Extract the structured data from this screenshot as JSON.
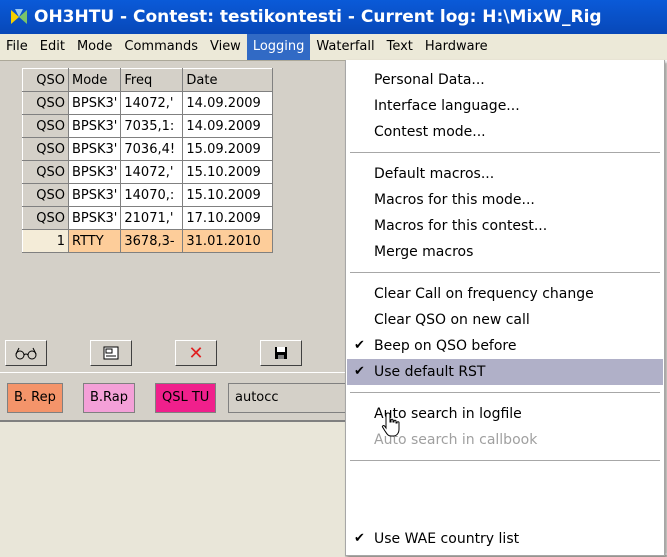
{
  "title": "OH3HTU - Contest: testikontesti - Current log: H:\\MixW_Rig",
  "menu": [
    "File",
    "Edit",
    "Mode",
    "Commands",
    "View",
    "Logging",
    "Waterfall",
    "Text",
    "Hardware"
  ],
  "table": {
    "headers": [
      "QSO",
      "Mode",
      "Freq",
      "Date"
    ],
    "rows": [
      [
        "QSO",
        "BPSK3'",
        "14072,'",
        "14.09.2009"
      ],
      [
        "QSO",
        "BPSK3'",
        "7035,1:",
        "14.09.2009"
      ],
      [
        "QSO",
        "BPSK3'",
        "7036,4!",
        "15.09.2009"
      ],
      [
        "QSO",
        "BPSK3'",
        "14072,'",
        "15.10.2009"
      ],
      [
        "QSO",
        "BPSK3'",
        "14070,:",
        "15.10.2009"
      ],
      [
        "QSO",
        "BPSK3'",
        "21071,'",
        "17.10.2009"
      ],
      [
        "1",
        "RTTY",
        "3678,3-",
        "31.01.2010"
      ]
    ]
  },
  "toolbar": [
    "glasses-icon",
    "card-icon",
    "delete-icon",
    "save-icon"
  ],
  "macros": [
    {
      "label": "B. Rep",
      "color": "#f4946a"
    },
    {
      "label": "B.Rap",
      "color": "#f4a0d8"
    },
    {
      "label": "QSL TU",
      "color": "#f0208c"
    },
    {
      "label": "autocc",
      "color": "#d4d0c8"
    }
  ],
  "logging_menu": {
    "items": [
      {
        "label": "Personal Data...",
        "checked": false,
        "disabled": false
      },
      {
        "label": "Interface language...",
        "checked": false,
        "disabled": false
      },
      {
        "label": "Contest mode...",
        "checked": false,
        "disabled": false
      },
      {
        "label": "Default macros...",
        "checked": false,
        "disabled": false
      },
      {
        "label": "Macros for this mode...",
        "checked": false,
        "disabled": false
      },
      {
        "label": "Macros for this contest...",
        "checked": false,
        "disabled": false
      },
      {
        "label": "Merge macros",
        "checked": false,
        "disabled": false
      },
      {
        "label": "Clear Call on frequency change",
        "checked": false,
        "disabled": false
      },
      {
        "label": "Clear QSO on new call",
        "checked": false,
        "disabled": false
      },
      {
        "label": "Beep on QSO before",
        "checked": true,
        "disabled": false
      },
      {
        "label": "Use default RST",
        "checked": true,
        "disabled": false,
        "highlighted": true
      },
      {
        "label": "Auto search in logfile",
        "checked": false,
        "disabled": false
      },
      {
        "label": "Auto search in callbook",
        "checked": false,
        "disabled": true
      },
      {
        "label": "Use WAE country list",
        "checked": true,
        "disabled": false
      }
    ]
  },
  "colors": {
    "titlebar": "#0a5ad8",
    "menu_highlight": "#316ac5",
    "item_highlight": "#b0b0c8",
    "current_row": "#fdcd9a"
  }
}
